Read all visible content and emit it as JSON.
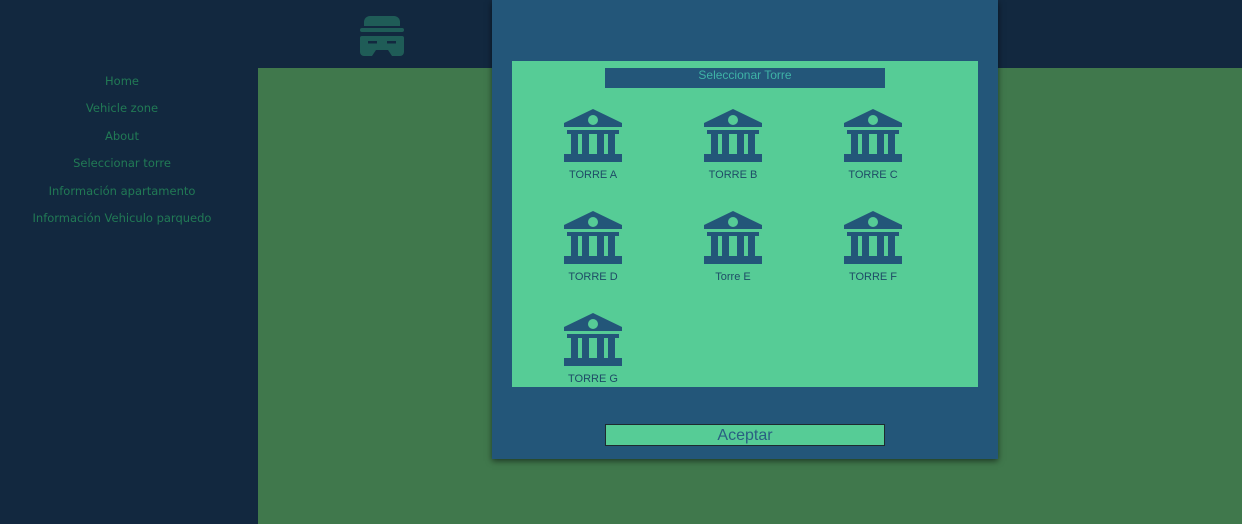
{
  "nav": {
    "items": [
      {
        "label": "Home"
      },
      {
        "label": "Vehicle zone"
      },
      {
        "label": "About"
      },
      {
        "label": "Seleccionar torre"
      },
      {
        "label": "Información apartamento"
      },
      {
        "label": "Información Vehiculo parquedo"
      }
    ]
  },
  "modal": {
    "title": "Seleccionar Torre",
    "towers": [
      {
        "label": "TORRE A"
      },
      {
        "label": "TORRE B"
      },
      {
        "label": "TORRE C"
      },
      {
        "label": "TORRE D"
      },
      {
        "label": "Torre E"
      },
      {
        "label": "TORRE F"
      },
      {
        "label": "TORRE G"
      }
    ],
    "accept_label": "Aceptar"
  },
  "icons": {
    "logo": "incognito-car-icon",
    "tower": "bank-building-icon"
  },
  "colors": {
    "sidebar_bg": "#12283f",
    "main_bg": "#40784c",
    "modal_bg": "#235679",
    "panel_bg": "#56cc96",
    "nav_text": "#217a55",
    "icon_color": "#235679"
  }
}
